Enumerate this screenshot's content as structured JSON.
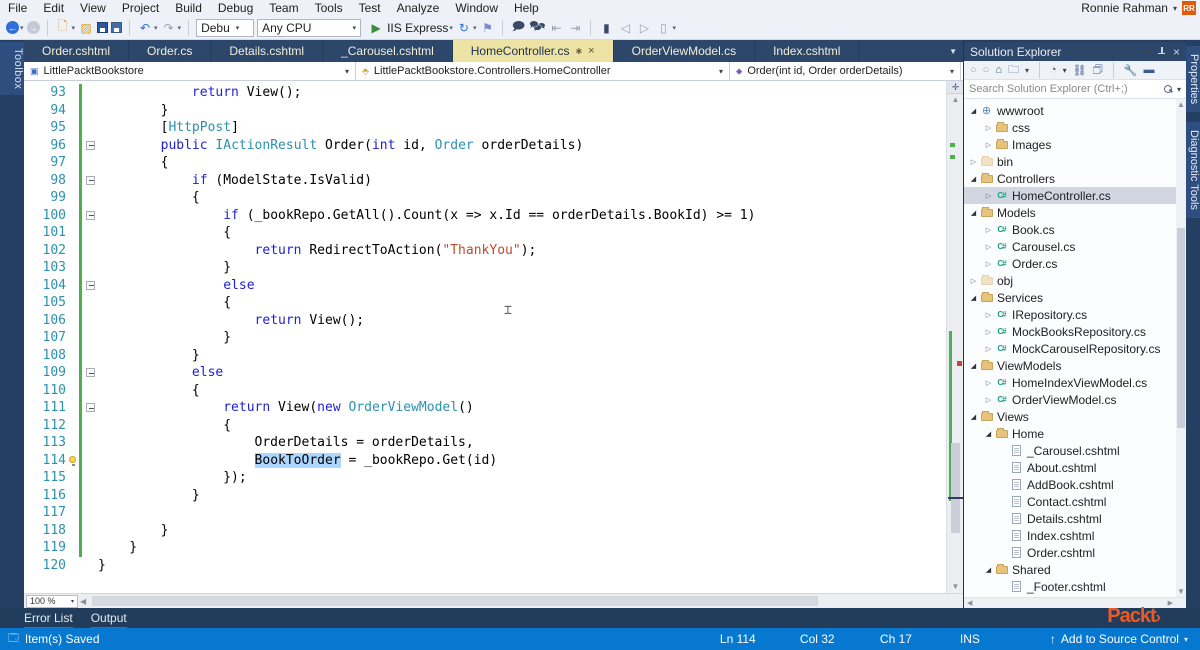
{
  "colors": {
    "accent_blue": "#0678CF",
    "active_tab_khaki": "#EDE3A4",
    "change_bar_green": "#4CB04F",
    "selection_blue": "#ADD6FF",
    "packt_orange": "#EE5A23",
    "keyword_blue": "#1F1FD3",
    "type_teal": "#2B91AF",
    "string_red": "#BF4B28",
    "line_number_teal": "#2B91AF"
  },
  "menu_bar": {
    "items": [
      "File",
      "Edit",
      "View",
      "Project",
      "Build",
      "Debug",
      "Team",
      "Tools",
      "Test",
      "Analyze",
      "Window",
      "Help"
    ],
    "user": {
      "name": "Ronnie Rahman",
      "initials": "RR"
    }
  },
  "toolbar": {
    "debug_config": "Debu",
    "platform": "Any CPU",
    "run_label": "IIS Express"
  },
  "left_rail": {
    "tab": "Toolbox"
  },
  "right_rail": {
    "tabs": [
      "Properties",
      "Diagnostic Tools"
    ]
  },
  "editor": {
    "tabs": [
      {
        "label": "Order.cshtml"
      },
      {
        "label": "Order.cs"
      },
      {
        "label": "Details.cshtml"
      },
      {
        "label": "_Carousel.cshtml"
      },
      {
        "label": "HomeController.cs",
        "active": true,
        "modified": true,
        "closable": true
      },
      {
        "label": "OrderViewModel.cs"
      },
      {
        "label": "Index.cshtml"
      }
    ],
    "breadcrumb": [
      {
        "label": "LittlePacktBookstore",
        "icon": "project-icon"
      },
      {
        "label": "LittlePacktBookstore.Controllers.HomeController",
        "icon": "class-icon"
      },
      {
        "label": "Order(int id, Order orderDetails)",
        "icon": "method-icon"
      }
    ],
    "zoom": "100 %",
    "code": {
      "lines": [
        {
          "n": 93,
          "chg": true,
          "segs": [
            [
              "pl",
              "            "
            ],
            [
              "kw",
              "return"
            ],
            [
              "pl",
              " View();"
            ]
          ]
        },
        {
          "n": 94,
          "chg": true,
          "segs": [
            [
              "pl",
              "        }"
            ]
          ]
        },
        {
          "n": 95,
          "chg": true,
          "segs": [
            [
              "pl",
              "        ["
            ],
            [
              "ty",
              "HttpPost"
            ],
            [
              "pl",
              "]"
            ]
          ]
        },
        {
          "n": 96,
          "chg": true,
          "fold": true,
          "segs": [
            [
              "pl",
              "        "
            ],
            [
              "kw",
              "public"
            ],
            [
              "pl",
              " "
            ],
            [
              "ty",
              "IActionResult"
            ],
            [
              "pl",
              " Order("
            ],
            [
              "kw",
              "int"
            ],
            [
              "pl",
              " id, "
            ],
            [
              "ty",
              "Order"
            ],
            [
              "pl",
              " orderDetails)"
            ]
          ]
        },
        {
          "n": 97,
          "chg": true,
          "segs": [
            [
              "pl",
              "        {"
            ]
          ]
        },
        {
          "n": 98,
          "chg": true,
          "fold": true,
          "segs": [
            [
              "pl",
              "            "
            ],
            [
              "kw",
              "if"
            ],
            [
              "pl",
              " (ModelState.IsValid)"
            ]
          ]
        },
        {
          "n": 99,
          "chg": true,
          "segs": [
            [
              "pl",
              "            {"
            ]
          ]
        },
        {
          "n": 100,
          "chg": true,
          "fold": true,
          "segs": [
            [
              "pl",
              "                "
            ],
            [
              "kw",
              "if"
            ],
            [
              "pl",
              " (_bookRepo.GetAll().Count(x => x.Id == orderDetails.BookId) >= 1)"
            ]
          ]
        },
        {
          "n": 101,
          "chg": true,
          "segs": [
            [
              "pl",
              "                {"
            ]
          ]
        },
        {
          "n": 102,
          "chg": true,
          "segs": [
            [
              "pl",
              "                    "
            ],
            [
              "kw",
              "return"
            ],
            [
              "pl",
              " RedirectToAction("
            ],
            [
              "st",
              "\"ThankYou\""
            ],
            [
              "pl",
              ");"
            ]
          ]
        },
        {
          "n": 103,
          "chg": true,
          "segs": [
            [
              "pl",
              "                }"
            ]
          ]
        },
        {
          "n": 104,
          "chg": true,
          "fold": true,
          "segs": [
            [
              "pl",
              "                "
            ],
            [
              "kw",
              "else"
            ]
          ]
        },
        {
          "n": 105,
          "chg": true,
          "segs": [
            [
              "pl",
              "                {"
            ]
          ]
        },
        {
          "n": 106,
          "chg": true,
          "segs": [
            [
              "pl",
              "                    "
            ],
            [
              "kw",
              "return"
            ],
            [
              "pl",
              " View();"
            ]
          ]
        },
        {
          "n": 107,
          "chg": true,
          "segs": [
            [
              "pl",
              "                }"
            ]
          ]
        },
        {
          "n": 108,
          "chg": true,
          "segs": [
            [
              "pl",
              "            }"
            ]
          ]
        },
        {
          "n": 109,
          "chg": true,
          "fold": true,
          "segs": [
            [
              "pl",
              "            "
            ],
            [
              "kw",
              "else"
            ]
          ]
        },
        {
          "n": 110,
          "chg": true,
          "segs": [
            [
              "pl",
              "            {"
            ]
          ]
        },
        {
          "n": 111,
          "chg": true,
          "fold": true,
          "segs": [
            [
              "pl",
              "                "
            ],
            [
              "kw",
              "return"
            ],
            [
              "pl",
              " View("
            ],
            [
              "kw",
              "new"
            ],
            [
              "pl",
              " "
            ],
            [
              "ty",
              "OrderViewModel"
            ],
            [
              "pl",
              "()"
            ]
          ]
        },
        {
          "n": 112,
          "chg": true,
          "segs": [
            [
              "pl",
              "                {"
            ]
          ]
        },
        {
          "n": 113,
          "chg": true,
          "segs": [
            [
              "pl",
              "                    OrderDetails = orderDetails,"
            ]
          ]
        },
        {
          "n": 114,
          "chg": true,
          "bulb": true,
          "segs": [
            [
              "pl",
              "                    "
            ],
            [
              "sel",
              "BookToOrder"
            ],
            [
              "pl",
              " = _bookRepo.Get(id)"
            ]
          ]
        },
        {
          "n": 115,
          "chg": true,
          "segs": [
            [
              "pl",
              "                });"
            ]
          ]
        },
        {
          "n": 116,
          "chg": true,
          "segs": [
            [
              "pl",
              "            }"
            ]
          ]
        },
        {
          "n": 117,
          "chg": true,
          "segs": []
        },
        {
          "n": 118,
          "chg": true,
          "segs": [
            [
              "pl",
              "        }"
            ]
          ]
        },
        {
          "n": 119,
          "chg": true,
          "segs": [
            [
              "pl",
              "    }"
            ]
          ]
        },
        {
          "n": 120,
          "chg": false,
          "segs": [
            [
              "pl",
              "}"
            ]
          ]
        }
      ]
    }
  },
  "solution_explorer": {
    "title": "Solution Explorer",
    "search_placeholder": "Search Solution Explorer (Ctrl+;)",
    "tree": [
      {
        "label": "wwwroot",
        "depth": 1,
        "icon": "globe",
        "exp": "open"
      },
      {
        "label": "css",
        "depth": 2,
        "icon": "folder",
        "exp": "closed"
      },
      {
        "label": "Images",
        "depth": 2,
        "icon": "folder",
        "exp": "closed"
      },
      {
        "label": "bin",
        "depth": 1,
        "icon": "folder-dim",
        "exp": "closed"
      },
      {
        "label": "Controllers",
        "depth": 1,
        "icon": "folder",
        "exp": "open"
      },
      {
        "label": "HomeController.cs",
        "depth": 2,
        "icon": "cs",
        "exp": "closed",
        "selected": true
      },
      {
        "label": "Models",
        "depth": 1,
        "icon": "folder",
        "exp": "open"
      },
      {
        "label": "Book.cs",
        "depth": 2,
        "icon": "cs",
        "exp": "closed"
      },
      {
        "label": "Carousel.cs",
        "depth": 2,
        "icon": "cs",
        "exp": "closed"
      },
      {
        "label": "Order.cs",
        "depth": 2,
        "icon": "cs",
        "exp": "closed"
      },
      {
        "label": "obj",
        "depth": 1,
        "icon": "folder-dim",
        "exp": "closed"
      },
      {
        "label": "Services",
        "depth": 1,
        "icon": "folder",
        "exp": "open"
      },
      {
        "label": "IRepository.cs",
        "depth": 2,
        "icon": "cs",
        "exp": "closed"
      },
      {
        "label": "MockBooksRepository.cs",
        "depth": 2,
        "icon": "cs",
        "exp": "closed"
      },
      {
        "label": "MockCarouselRepository.cs",
        "depth": 2,
        "icon": "cs",
        "exp": "closed"
      },
      {
        "label": "ViewModels",
        "depth": 1,
        "icon": "folder",
        "exp": "open"
      },
      {
        "label": "HomeIndexViewModel.cs",
        "depth": 2,
        "icon": "cs",
        "exp": "closed"
      },
      {
        "label": "OrderViewModel.cs",
        "depth": 2,
        "icon": "cs",
        "exp": "closed"
      },
      {
        "label": "Views",
        "depth": 1,
        "icon": "folder",
        "exp": "open"
      },
      {
        "label": "Home",
        "depth": 2,
        "icon": "folder",
        "exp": "open"
      },
      {
        "label": "_Carousel.cshtml",
        "depth": 3,
        "icon": "page"
      },
      {
        "label": "About.cshtml",
        "depth": 3,
        "icon": "page"
      },
      {
        "label": "AddBook.cshtml",
        "depth": 3,
        "icon": "page"
      },
      {
        "label": "Contact.cshtml",
        "depth": 3,
        "icon": "page"
      },
      {
        "label": "Details.cshtml",
        "depth": 3,
        "icon": "page"
      },
      {
        "label": "Index.cshtml",
        "depth": 3,
        "icon": "page"
      },
      {
        "label": "Order.cshtml",
        "depth": 3,
        "icon": "page"
      },
      {
        "label": "Shared",
        "depth": 2,
        "icon": "folder",
        "exp": "open"
      },
      {
        "label": "_Footer.cshtml",
        "depth": 3,
        "icon": "page"
      }
    ]
  },
  "bottom_panel": {
    "tabs": [
      "Error List",
      "Output"
    ],
    "logo": "Packt"
  },
  "status_bar": {
    "message": "Item(s) Saved",
    "line": "Ln 114",
    "column": "Col 32",
    "character": "Ch 17",
    "mode": "INS",
    "source_control": "Add to Source Control"
  }
}
